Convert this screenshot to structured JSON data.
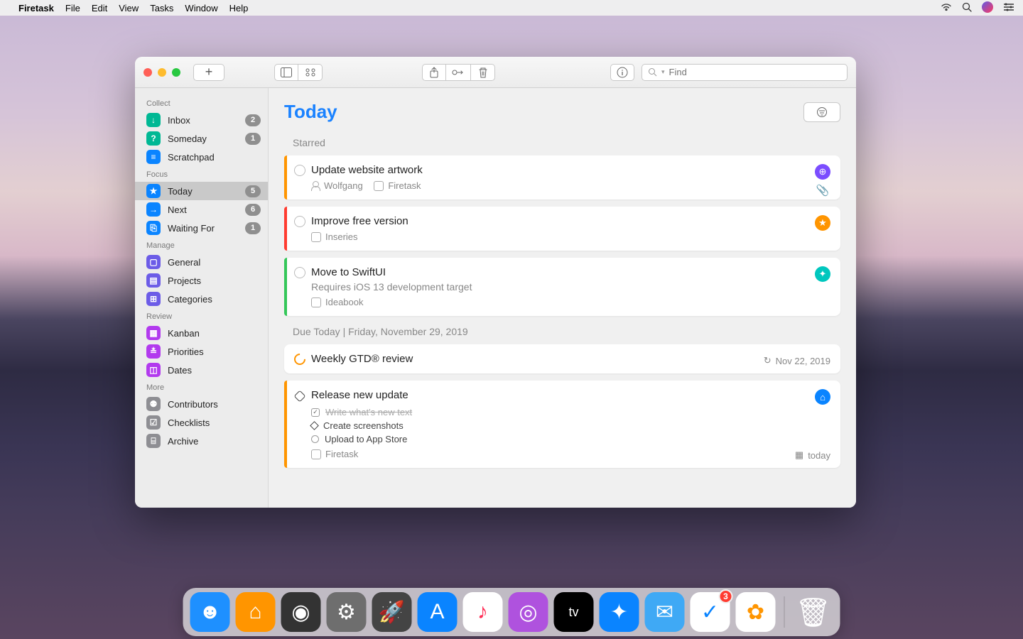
{
  "menubar": {
    "app": "Firetask",
    "items": [
      "File",
      "Edit",
      "View",
      "Tasks",
      "Window",
      "Help"
    ]
  },
  "toolbar": {
    "search_placeholder": "Find"
  },
  "sidebar": {
    "sections": [
      {
        "header": "Collect",
        "items": [
          {
            "icon": "↓",
            "color": "#00b894",
            "label": "Inbox",
            "badge": "2"
          },
          {
            "icon": "?",
            "color": "#00b894",
            "label": "Someday",
            "badge": "1"
          },
          {
            "icon": "≡",
            "color": "#0a84ff",
            "label": "Scratchpad",
            "badge": ""
          }
        ]
      },
      {
        "header": "Focus",
        "items": [
          {
            "icon": "★",
            "color": "#0a84ff",
            "label": "Today",
            "badge": "5",
            "selected": true
          },
          {
            "icon": "→",
            "color": "#0a84ff",
            "label": "Next",
            "badge": "6"
          },
          {
            "icon": "⎘",
            "color": "#0a84ff",
            "label": "Waiting For",
            "badge": "1"
          }
        ]
      },
      {
        "header": "Manage",
        "items": [
          {
            "icon": "▢",
            "color": "#6c5ce7",
            "label": "General",
            "badge": ""
          },
          {
            "icon": "▤",
            "color": "#6c5ce7",
            "label": "Projects",
            "badge": ""
          },
          {
            "icon": "⊞",
            "color": "#6c5ce7",
            "label": "Categories",
            "badge": ""
          }
        ]
      },
      {
        "header": "Review",
        "items": [
          {
            "icon": "▦",
            "color": "#b23aee",
            "label": "Kanban",
            "badge": ""
          },
          {
            "icon": "≛",
            "color": "#b23aee",
            "label": "Priorities",
            "badge": ""
          },
          {
            "icon": "◫",
            "color": "#b23aee",
            "label": "Dates",
            "badge": ""
          }
        ]
      },
      {
        "header": "More",
        "items": [
          {
            "icon": "⚉",
            "color": "#8e8e93",
            "label": "Contributors",
            "badge": ""
          },
          {
            "icon": "☑",
            "color": "#8e8e93",
            "label": "Checklists",
            "badge": ""
          },
          {
            "icon": "⌸",
            "color": "#8e8e93",
            "label": "Archive",
            "badge": ""
          }
        ]
      }
    ]
  },
  "main": {
    "title": "Today",
    "section_starred": "Starred",
    "section_due": "Due Today  |  Friday, November 29, 2019",
    "tasks": {
      "starred": [
        {
          "stripe": "#ff9500",
          "title": "Update website artwork",
          "note": "",
          "person": "Wolfgang",
          "project": "Firetask",
          "badges": [
            {
              "color": "#7b4dff",
              "glyph": "⊕"
            }
          ],
          "attachment": true
        },
        {
          "stripe": "#ff3b30",
          "title": "Improve free version",
          "note": "",
          "project": "Inseries",
          "badges": [
            {
              "color": "#ff9500",
              "glyph": "★"
            }
          ]
        },
        {
          "stripe": "#34c759",
          "title": "Move to SwiftUI",
          "note": "Requires iOS 13 development target",
          "project": "Ideabook",
          "badges": [
            {
              "color": "#00c7be",
              "glyph": "✦"
            }
          ]
        }
      ],
      "due": [
        {
          "stripe": "transparent",
          "title": "Weekly GTD® review",
          "check": "progress",
          "repeat_date": "Nov 22, 2019"
        },
        {
          "stripe": "#ff9500",
          "title": "Release new update",
          "check": "diamond",
          "subtasks": [
            {
              "state": "done",
              "label": "Write what's new text"
            },
            {
              "state": "active",
              "label": "Create screenshots"
            },
            {
              "state": "open",
              "label": "Upload to App Store"
            }
          ],
          "project": "Firetask",
          "badges": [
            {
              "color": "#0a84ff",
              "glyph": "⌂"
            }
          ],
          "due_label": "today"
        }
      ]
    }
  },
  "dock": {
    "items": [
      {
        "name": "finder",
        "color": "#1e90ff",
        "glyph": "☻"
      },
      {
        "name": "home",
        "color": "#ff9500",
        "glyph": "⌂"
      },
      {
        "name": "siri",
        "color": "#333",
        "glyph": "◉"
      },
      {
        "name": "settings",
        "color": "#6e6e6e",
        "glyph": "⚙"
      },
      {
        "name": "launchpad",
        "color": "#444",
        "glyph": "🚀"
      },
      {
        "name": "appstore",
        "color": "#0a84ff",
        "glyph": "A"
      },
      {
        "name": "music",
        "color": "#fff",
        "glyph": "♪",
        "fg": "#ff2d55"
      },
      {
        "name": "podcasts",
        "color": "#af52de",
        "glyph": "◎"
      },
      {
        "name": "tv",
        "color": "#000",
        "glyph": "tv",
        "small": true
      },
      {
        "name": "safari",
        "color": "#0a84ff",
        "glyph": "✦"
      },
      {
        "name": "mail",
        "color": "#3fa9f5",
        "glyph": "✉"
      },
      {
        "name": "things",
        "color": "#fff",
        "glyph": "✓",
        "fg": "#0a84ff",
        "badge": "3"
      },
      {
        "name": "photos",
        "color": "#fff",
        "glyph": "✿",
        "fg": "#ff9500"
      }
    ],
    "trash": {
      "glyph": "🗑"
    }
  }
}
